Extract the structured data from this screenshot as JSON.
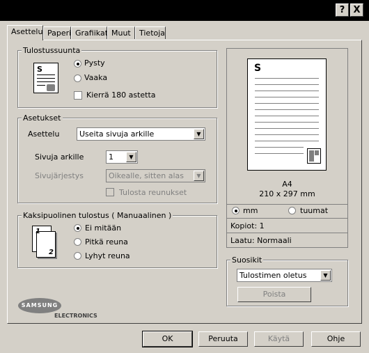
{
  "titlebar": {
    "help_label": "?",
    "close_label": "X"
  },
  "tabs": [
    {
      "label": "Asettelu",
      "active": true
    },
    {
      "label": "Paperi"
    },
    {
      "label": "Grafiikat"
    },
    {
      "label": "Muut"
    },
    {
      "label": "Tietoja"
    }
  ],
  "orientation": {
    "title": "Tulostussuunta",
    "options": [
      "Pysty",
      "Vaaka"
    ],
    "selected": "Pysty",
    "rotate_label": "Kierrä 180 astetta",
    "icon_letter": "S"
  },
  "settings": {
    "title": "Asetukset",
    "layout_label": "Asettelu",
    "layout_value": "Useita sivuja arkille",
    "pages_label": "Sivuja arkille",
    "pages_value": "1",
    "order_label": "Sivujärjestys",
    "order_value": "Oikealle, sitten alas",
    "borders_label": "Tulosta reunukset"
  },
  "duplex": {
    "title": "Kaksipuolinen tulostus ( Manuaalinen )",
    "options": [
      "Ei mitään",
      "Pitkä reuna",
      "Lyhyt reuna"
    ],
    "selected": "Ei mitään",
    "icon_labels": [
      "1",
      "2"
    ]
  },
  "preview": {
    "page_letter": "S",
    "paper_name": "A4",
    "paper_size": "210 x 297 mm",
    "units": [
      "mm",
      "tuumat"
    ],
    "unit_selected": "mm",
    "copies": "Kopiot: 1",
    "quality": "Laatu: Normaali"
  },
  "favorites": {
    "title": "Suosikit",
    "value": "Tulostimen oletus",
    "delete_label": "Poista"
  },
  "logo": {
    "brand": "SAMSUNG",
    "sub": "ELECTRONICS"
  },
  "footer": {
    "ok": "OK",
    "cancel": "Peruuta",
    "apply": "Käytä",
    "help": "Ohje"
  }
}
